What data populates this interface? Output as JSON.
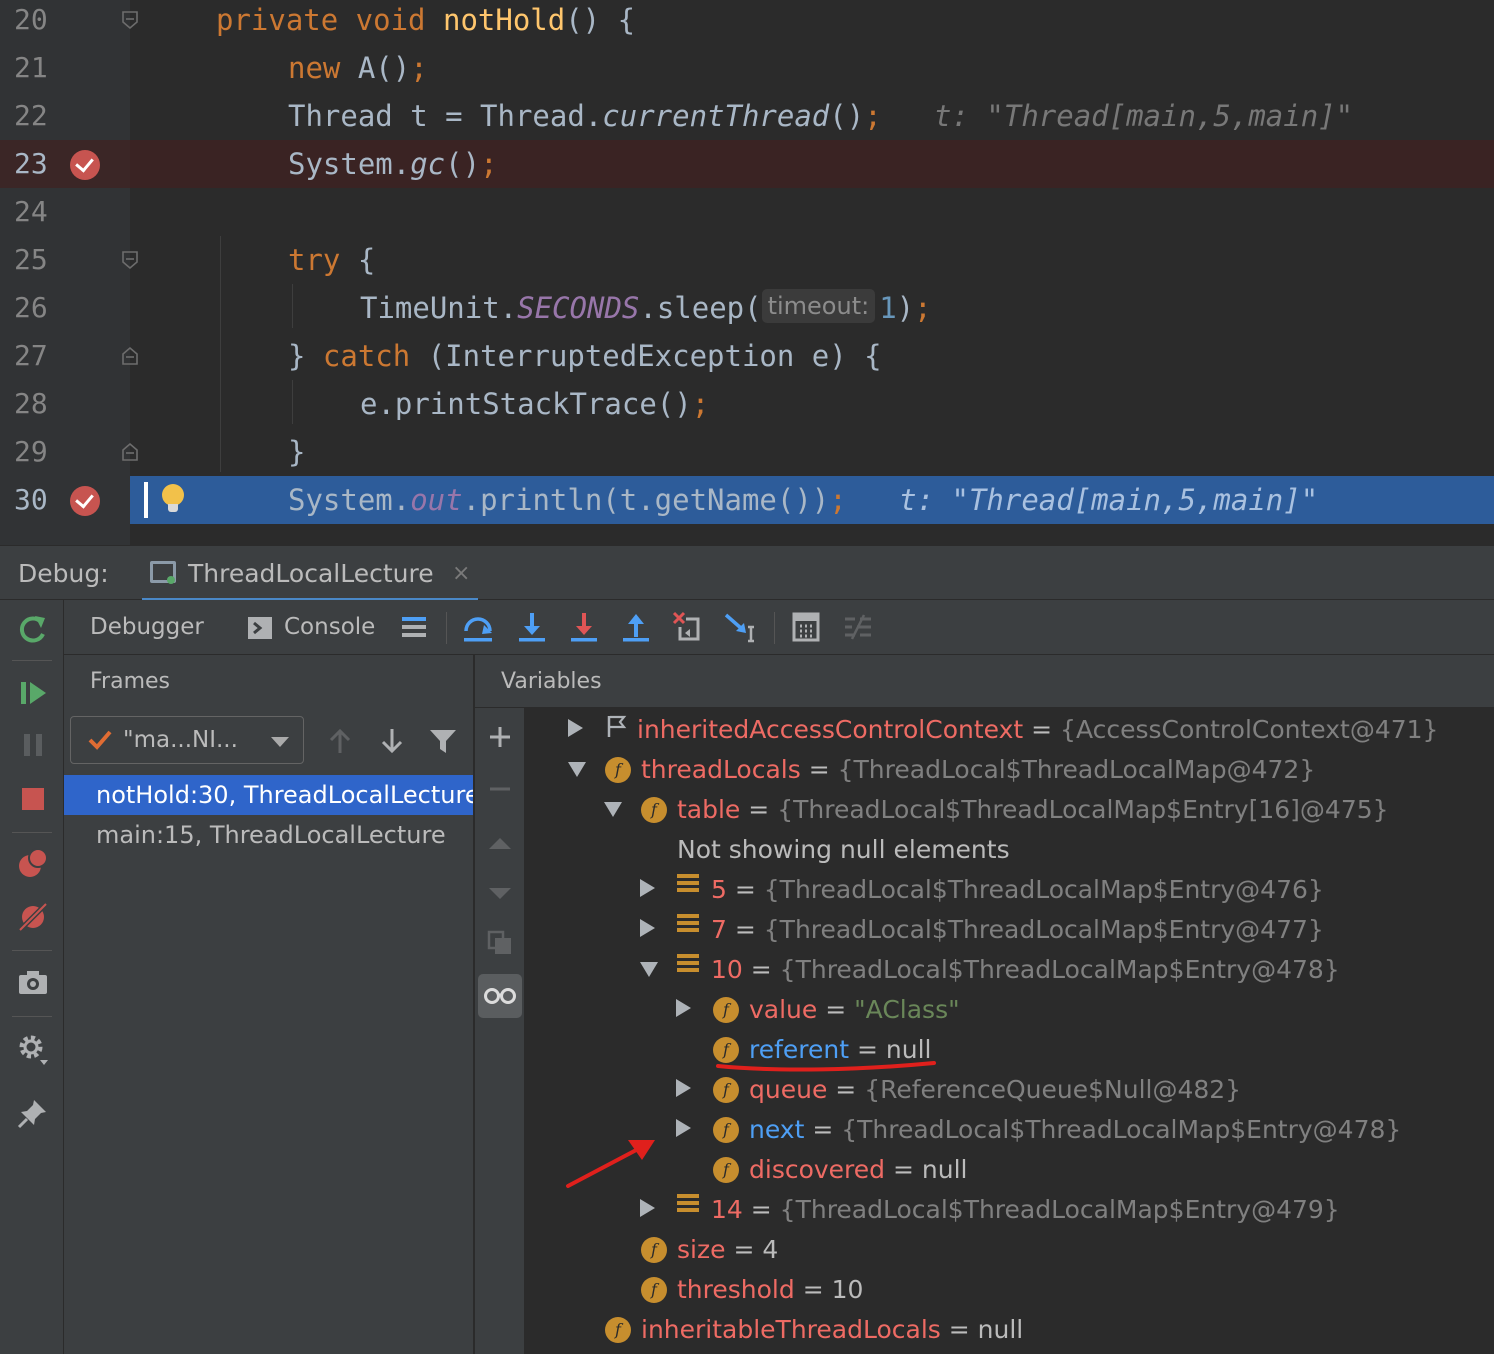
{
  "editor": {
    "lines": [
      {
        "num": "20",
        "code": "<span class=\"kw\">private void </span><span class=\"fn\">notHold</span>() {"
      },
      {
        "num": "21",
        "code": "<span class=\"kw\">new </span>A()<span class=\"kw\">;</span>"
      },
      {
        "num": "22",
        "code": "Thread t = Thread.<span class=\"it\">currentThread</span>()<span class=\"kw\">;</span>   <span class=\"hint\">t: \"Thread[main,5,main]\"</span>"
      },
      {
        "num": "23",
        "code": "System.<span class=\"it\">gc</span>()<span class=\"kw\">;</span>"
      },
      {
        "num": "24",
        "code": ""
      },
      {
        "num": "25",
        "code": "<span class=\"kw\">try </span>{"
      },
      {
        "num": "26",
        "code": "TimeUnit.<span class=\"st\">SECONDS</span>.sleep(<span class=\"param-hint\">timeout:</span><span class=\"num\">1</span>)<span class=\"kw\">;</span>"
      },
      {
        "num": "27",
        "code": "} <span class=\"kw\">catch </span>(InterruptedException e) {"
      },
      {
        "num": "28",
        "code": "e.printStackTrace()<span class=\"kw\">;</span>"
      },
      {
        "num": "29",
        "code": "}"
      },
      {
        "num": "30",
        "code": "System.<span class=\"st\">out</span>.println(t.getName())<span class=\"kw\">;</span>   <span class=\"hint\">t: \"Thread[main,5,main]\"</span>"
      }
    ]
  },
  "debug": {
    "title": "Debug:",
    "session": "ThreadLocalLecture",
    "close_glyph": "×",
    "tabs": {
      "debugger": "Debugger",
      "console": "Console"
    }
  },
  "frames": {
    "title": "Frames",
    "thread": "\"ma...NI...",
    "items": [
      "notHold:30, ThreadLocalLecture",
      "main:15, ThreadLocalLecture"
    ]
  },
  "variables": {
    "title": "Variables",
    "rows": [
      {
        "name": "inheritedAccessControlContext",
        "eq": "=",
        "value": "{AccessControlContext@471}"
      },
      {
        "name": "threadLocals",
        "eq": "=",
        "value": "{ThreadLocal$ThreadLocalMap@472}"
      },
      {
        "name": "table",
        "eq": "=",
        "value": "{ThreadLocal$ThreadLocalMap$Entry[16]@475}"
      },
      {
        "note": "Not showing null elements"
      },
      {
        "name": "5",
        "eq": "=",
        "value": "{ThreadLocal$ThreadLocalMap$Entry@476}"
      },
      {
        "name": "7",
        "eq": "=",
        "value": "{ThreadLocal$ThreadLocalMap$Entry@477}"
      },
      {
        "name": "10",
        "eq": "=",
        "value": "{ThreadLocal$ThreadLocalMap$Entry@478}"
      },
      {
        "name": "value",
        "eq": "=",
        "value": "\"AClass\""
      },
      {
        "name": "referent",
        "eq": "=",
        "value": "null"
      },
      {
        "name": "queue",
        "eq": "=",
        "value": "{ReferenceQueue$Null@482}"
      },
      {
        "name": "next",
        "eq": "=",
        "value": "{ThreadLocal$ThreadLocalMap$Entry@478}"
      },
      {
        "name": "discovered",
        "eq": "=",
        "value": "null"
      },
      {
        "name": "14",
        "eq": "=",
        "value": "{ThreadLocal$ThreadLocalMap$Entry@479}"
      },
      {
        "name": "size",
        "eq": "=",
        "value": "4"
      },
      {
        "name": "threshold",
        "eq": "=",
        "value": "10"
      },
      {
        "name": "inheritableThreadLocals",
        "eq": "=",
        "value": "null"
      }
    ]
  },
  "icons": {
    "field": "f",
    "breakpoint": "breakpoint-icon",
    "lightbulb": "lightbulb-icon"
  },
  "colors": {
    "accent": "#2f65ca",
    "annotation": "#e0201c",
    "field_name": "#ee6b64",
    "field_name_changed": "#4e9ff5"
  }
}
